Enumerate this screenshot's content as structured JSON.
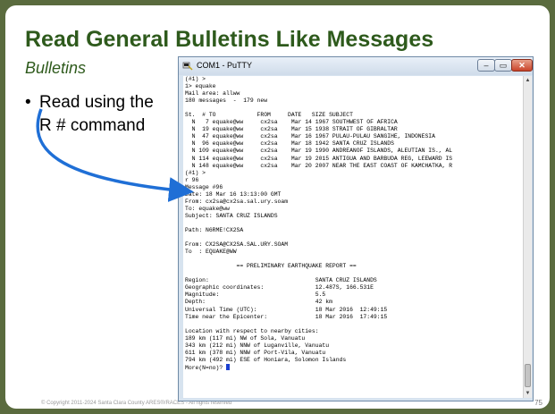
{
  "slide": {
    "title": "Read General Bulletins Like Messages",
    "subtitle": "Bulletins",
    "bullet_marker": "•",
    "bullet_text": "Read using the R # command",
    "footer_copyright": "© Copyright 2011-2024 Santa Clara County ARES®/RACES - All rights reserved",
    "page_number": "75"
  },
  "putty": {
    "title": "COM1 - PuTTY",
    "minimize": "–",
    "maximize": "▭",
    "close": "✕",
    "scroll_up": "▲",
    "scroll_down": "▼",
    "terminal_lines": [
      "(#1) >",
      "1> equake",
      "Mail area: allww",
      "180 messages  -  179 new",
      "",
      "St.  # TO            FROM     DATE   SIZE SUBJECT",
      "  N   7 equake@ww     cx2sa    Mar 14 1967 SOUTHWEST OF AFRICA",
      "  N  19 equake@ww     cx2sa    Mar 15 1938 STRAIT OF GIBRALTAR",
      "  N  47 equake@ww     cx2sa    Mar 16 1967 PULAU-PULAU SANGIHE, INDONESIA",
      "  N  96 equake@ww     cx2sa    Mar 18 1942 SANTA CRUZ ISLANDS",
      "  N 109 equake@ww     cx2sa    Mar 19 1990 ANDREANOF ISLANDS, ALEUTIAN IS., AL",
      "  N 114 equake@ww     cx2sa    Mar 19 2015 ANTIGUA AND BARBUDA REG, LEEWARD IS",
      "  N 148 equake@ww     cx2sa    Mar 20 2007 NEAR THE EAST COAST OF KAMCHATKA, R",
      "(#1) >",
      "r 96",
      "Message #96",
      "Date: 18 Mar 16 13:13:00 GMT",
      "From: cx2sa@cx2sa.sal.ury.soam",
      "To: equake@ww",
      "Subject: SANTA CRUZ ISLANDS",
      "",
      "Path: N6RME!CX2SA",
      "",
      "From: CX2SA@CX2SA.SAL.URY.SOAM",
      "To  : EQUAKE@WW",
      "",
      "               == PRELIMINARY EARTHQUAKE REPORT ==",
      "",
      "Region:                               SANTA CRUZ ISLANDS",
      "Geographic coordinates:               12.487S, 166.531E",
      "Magnitude:                            5.5",
      "Depth:                                42 km",
      "Universal Time (UTC):                 18 Mar 2016  12:49:15",
      "Time near the Epicenter:              18 Mar 2016  17:49:15",
      "",
      "Location with respect to nearby cities:",
      "189 km (117 mi) NW of Sola, Vanuatu",
      "343 km (212 mi) NNW of Luganville, Vanuatu",
      "611 km (378 mi) NNW of Port-Vila, Vanuatu",
      "794 km (492 mi) ESE of Honiara, Solomon Islands",
      "More(N=no)? "
    ]
  },
  "colors": {
    "title_green": "#2e5a1c",
    "arrow_blue": "#1f6fd6",
    "cursor_blue": "#1a3fd0"
  }
}
